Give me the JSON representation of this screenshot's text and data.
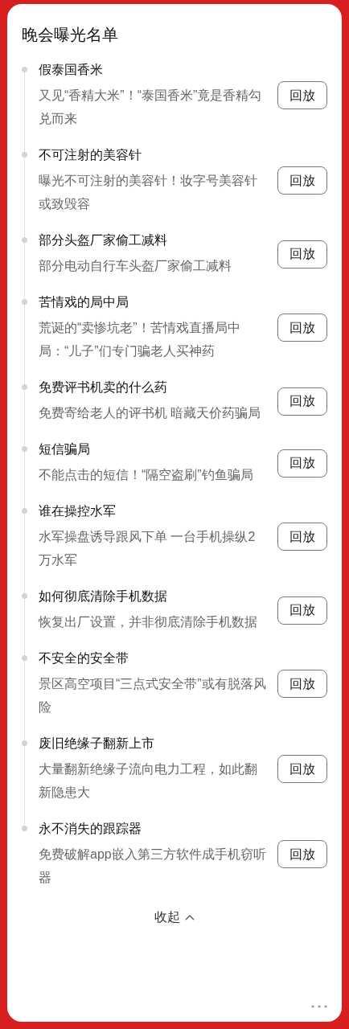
{
  "title": "晚会曝光名单",
  "items": [
    {
      "title": "假泰国香米",
      "description": "又见“香精大米”！“泰国香米”竟是香精勾兑而来",
      "button": "回放"
    },
    {
      "title": "不可注射的美容针",
      "description": "曝光不可注射的美容针！妆字号美容针或致毁容",
      "button": "回放"
    },
    {
      "title": "部分头盔厂家偷工减料",
      "description": "部分电动自行车头盔厂家偷工减料",
      "button": "回放"
    },
    {
      "title": "苦情戏的局中局",
      "description": "荒诞的“卖惨坑老”！苦情戏直播局中局：“儿子”们专门骗老人买神药",
      "button": "回放"
    },
    {
      "title": "免费评书机卖的什么药",
      "description": "免费寄给老人的评书机 暗藏天价药骗局",
      "button": "回放"
    },
    {
      "title": "短信骗局",
      "description": "不能点击的短信！“隔空盗刷”钓鱼骗局",
      "button": "回放"
    },
    {
      "title": "谁在操控水军",
      "description": "水军操盘诱导跟风下单 一台手机操纵2万水军",
      "button": "回放"
    },
    {
      "title": "如何彻底清除手机数据",
      "description": "恢复出厂设置，并非彻底清除手机数据",
      "button": "回放"
    },
    {
      "title": "不安全的安全带",
      "description": "景区高空项目“三点式安全带”或有脱落风险",
      "button": "回放"
    },
    {
      "title": "废旧绝缘子翻新上市",
      "description": "大量翻新绝缘子流向电力工程，如此翻新隐患大",
      "button": "回放"
    },
    {
      "title": "永不消失的跟踪器",
      "description": "免费破解app嵌入第三方软件成手机窃听器",
      "button": "回放"
    }
  ],
  "collapse": "收起"
}
